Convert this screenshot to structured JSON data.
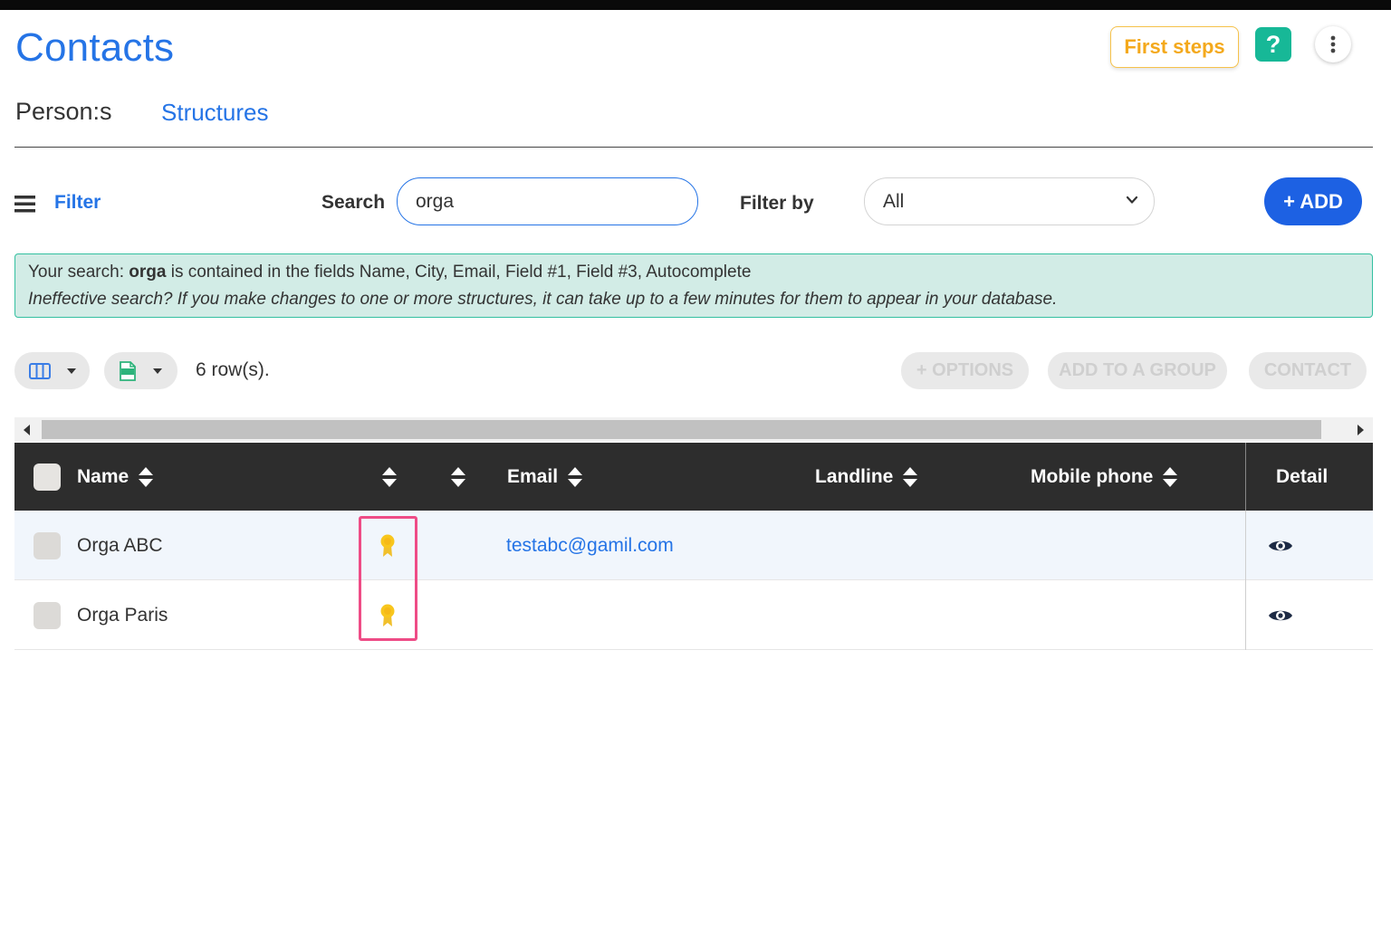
{
  "header": {
    "title": "Contacts",
    "first_steps_label": "First steps",
    "help_label": "?"
  },
  "tabs": [
    {
      "label": "Person:s",
      "active": true
    },
    {
      "label": "Structures",
      "active": false
    }
  ],
  "toolbar": {
    "filter_label": "Filter",
    "search_label": "Search",
    "search_value": "orga",
    "filter_by_label": "Filter by",
    "filter_by_value": "All",
    "add_label": "+ ADD"
  },
  "info": {
    "prefix": "Your search: ",
    "term": "orga",
    "suffix": " is contained in the fields Name, City, Email, Field #1, Field #3, Autocomplete",
    "note": "Ineffective search? If you make changes to one or more structures, it can take up to a few minutes for them to appear in your database."
  },
  "list_controls": {
    "row_count": "6 row(s).",
    "options_label": "+ OPTIONS",
    "add_to_group_label": "ADD TO A GROUP",
    "contact_label": "CONTACT"
  },
  "table": {
    "columns": {
      "name": "Name",
      "email": "Email",
      "landline": "Landline",
      "mobile": "Mobile phone",
      "detail": "Detail"
    },
    "rows": [
      {
        "name": "Orga ABC",
        "email": "testabc@gamil.com",
        "landline": "",
        "mobile": "",
        "badge": "award-ribbon-icon"
      },
      {
        "name": "Orga Paris",
        "email": "",
        "landline": "",
        "mobile": "",
        "badge": "award-ribbon-icon"
      }
    ]
  },
  "colors": {
    "accent": "#2574e6",
    "add_button": "#1d61e3",
    "help_button": "#17b897",
    "first_steps": "#f4a91c",
    "highlight": "#ee4c86",
    "header_bg": "#2d2d2d",
    "info_bg": "#d2ece6"
  }
}
